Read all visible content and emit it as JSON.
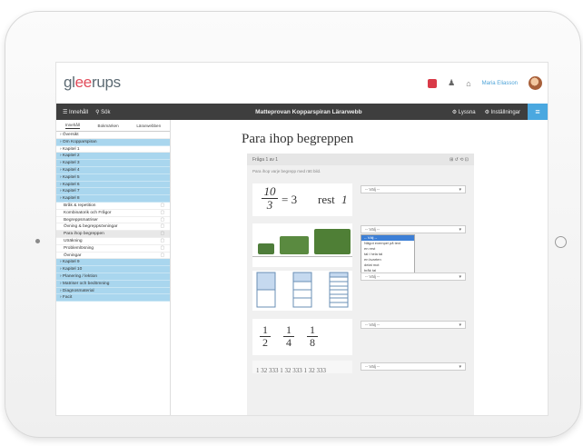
{
  "logo": {
    "prefix": "gl",
    "highlight": "ee",
    "suffix": "rups"
  },
  "top": {
    "user": "Maria Eliasson"
  },
  "nav": {
    "left1": "☰ Innehåll",
    "left2": "⚲ Sök",
    "title": "Matteprovan Kopparspiran Lärarwebb",
    "right1": "⚙ Lyssna",
    "right2": "⚙ Inställningar",
    "menu": "≡"
  },
  "sidebar": {
    "tabs": [
      "Innehåll",
      "Bokmärken",
      "Lärarwebben"
    ],
    "items": [
      {
        "label": "› Översikt",
        "style": "white"
      },
      {
        "label": "› Om Kopparspiran",
        "style": "blue"
      },
      {
        "label": "› Kapitel 1",
        "style": "white"
      },
      {
        "label": "› Kapitel 2",
        "style": "blue"
      },
      {
        "label": "› Kapitel 3",
        "style": "blue"
      },
      {
        "label": "› Kapitel 4",
        "style": "blue"
      },
      {
        "label": "› Kapitel 5",
        "style": "blue"
      },
      {
        "label": "› Kapitel 6",
        "style": "blue"
      },
      {
        "label": "› Kapitel 7",
        "style": "blue"
      },
      {
        "label": "› Kapitel 8",
        "style": "blue"
      },
      {
        "label": "Bråk & repetition",
        "style": "sub"
      },
      {
        "label": "Kombinatorik och Frågor",
        "style": "sub"
      },
      {
        "label": "Begreppsmatriser",
        "style": "sub"
      },
      {
        "label": "Övning & begreppsövningar",
        "style": "sub"
      },
      {
        "label": "Para ihop begreppen",
        "style": "sub sel"
      },
      {
        "label": "Uträkning",
        "style": "sub"
      },
      {
        "label": "Problemlösning",
        "style": "sub"
      },
      {
        "label": "Övningar",
        "style": "sub"
      },
      {
        "label": "› Kapitel 9",
        "style": "blue"
      },
      {
        "label": "› Kapitel 10",
        "style": "blue"
      },
      {
        "label": "› Planering / lektion",
        "style": "blue"
      },
      {
        "label": "› Matriser och bedömning",
        "style": "blue"
      },
      {
        "label": "› Diagnosmaterial",
        "style": "blue"
      },
      {
        "label": "› Facit",
        "style": "blue"
      }
    ]
  },
  "main": {
    "title": "Para ihop begreppen",
    "panel_title": "Fråga 1 av 1",
    "instructions": "Para ihop varje begrepp med rätt bild.",
    "fraction": {
      "num": "10",
      "den": "3",
      "eq": "= 3",
      "rest": "rest",
      "rest_val": "1"
    },
    "fractions_row": [
      {
        "num": "1",
        "den": "2"
      },
      {
        "num": "1",
        "den": "4"
      },
      {
        "num": "1",
        "den": "8"
      }
    ],
    "numbers_row": "1 32 333  1 32 333  1 32 333",
    "select_default": "-- Välj --",
    "dropdown_options": [
      "-- Välj --",
      "Något exempel på text",
      "en rest",
      "tal i hela tal",
      "en kvarten",
      "delat mot",
      "bråk tal"
    ]
  }
}
